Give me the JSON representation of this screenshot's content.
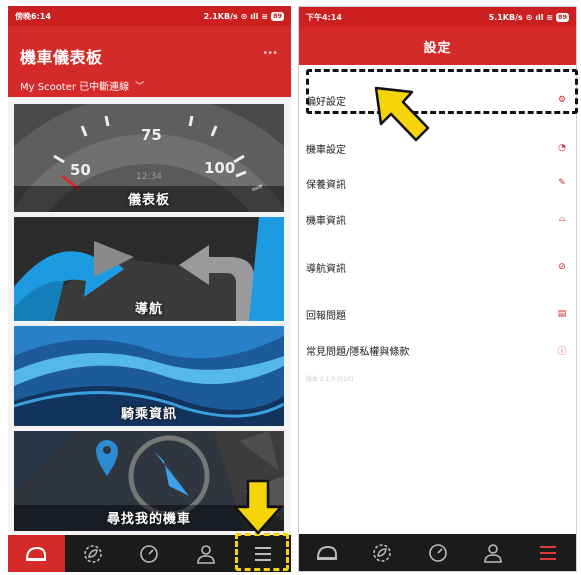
{
  "left": {
    "status": {
      "time": "傍晚6:14",
      "speed": "2.1KB/s",
      "battery": "89"
    },
    "header": {
      "title": "機車儀表板",
      "more": "•••",
      "connection": "My Scooter 已中斷連線"
    },
    "tiles": [
      {
        "label": "儀表板",
        "gauge_numbers": [
          "50",
          "75",
          "100"
        ],
        "clock": "12:34"
      },
      {
        "label": "導航"
      },
      {
        "label": "騎乘資訊"
      },
      {
        "label": "尋找我的機車"
      }
    ]
  },
  "right": {
    "status": {
      "time": "下午4:14",
      "speed": "5.1KB/s",
      "battery": "89"
    },
    "header": {
      "title": "設定"
    },
    "rows": [
      {
        "label": "偏好設定",
        "icon": "gear-icon"
      },
      {
        "label": "機車設定",
        "icon": "speedometer-icon"
      },
      {
        "label": "保養資訊",
        "icon": "wrench-icon"
      },
      {
        "label": "機車資訊",
        "icon": "scooter-icon"
      },
      {
        "label": "導航資訊",
        "icon": "compass-icon"
      },
      {
        "label": "回報問題",
        "icon": "document-icon"
      },
      {
        "label": "常見問題/隱私權與條款",
        "icon": "question-icon"
      }
    ],
    "version": "版本 2.1.0 (510)"
  },
  "nav_icons": [
    "helmet-icon",
    "leaf-gear-icon",
    "speedometer-icon",
    "person-icon",
    "menu-icon"
  ],
  "colors": {
    "brand_red": "#d42a2a",
    "highlight_yellow": "#f5d40a"
  }
}
